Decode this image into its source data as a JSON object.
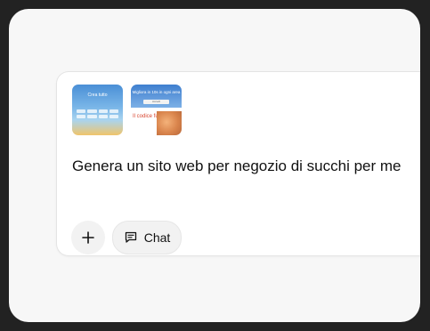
{
  "composer": {
    "prompt_text": "Genera un sito web per negozio di succhi per me",
    "chat_label": "Chat"
  },
  "thumbnails": [
    {
      "title": "Crea tutto"
    },
    {
      "title": "Migliora in 10s in ogni area",
      "button": "Accedi",
      "headline": "Il codice funziona"
    }
  ],
  "icons": {
    "add": "plus-icon",
    "chat": "chat-bubble-icon"
  },
  "colors": {
    "background": "#f7f7f7",
    "card": "#ffffff",
    "accent_red": "#d8452f"
  }
}
